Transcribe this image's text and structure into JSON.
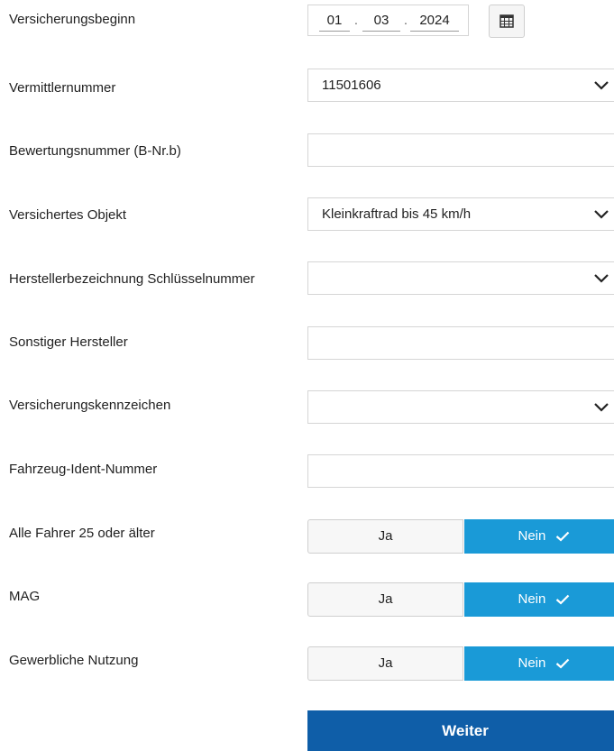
{
  "insurance_start": {
    "label": "Versicherungsbeginn",
    "day": "01",
    "month": "03",
    "year": "2024",
    "calendar_icon": "calendar-icon"
  },
  "broker_number": {
    "label": "Vermittlernummer",
    "value": "11501606"
  },
  "rating_number": {
    "label": "Bewertungsnummer (B-Nr.b)",
    "value": ""
  },
  "insured_object": {
    "label": "Versichertes Objekt",
    "value": "Kleinkraftrad bis 45 km/h"
  },
  "manufacturer_key": {
    "label": "Herstellerbezeichnung Schlüsselnummer",
    "value": ""
  },
  "other_manufacturer": {
    "label": "Sonstiger Hersteller",
    "value": ""
  },
  "insurance_plate": {
    "label": "Versicherungskennzeichen",
    "value": ""
  },
  "vehicle_id": {
    "label": "Fahrzeug-Ident-Nummer",
    "value": ""
  },
  "all_drivers_25": {
    "label": "Alle Fahrer 25 oder älter",
    "yes": "Ja",
    "no": "Nein",
    "selected": "no"
  },
  "mag": {
    "label": "MAG",
    "yes": "Ja",
    "no": "Nein",
    "selected": "no"
  },
  "commercial_use": {
    "label": "Gewerbliche Nutzung",
    "yes": "Ja",
    "no": "Nein",
    "selected": "no"
  },
  "next_button": {
    "label": "Weiter"
  },
  "colors": {
    "selected_toggle": "#1a9ad7",
    "primary_button": "#0f5ea8"
  }
}
